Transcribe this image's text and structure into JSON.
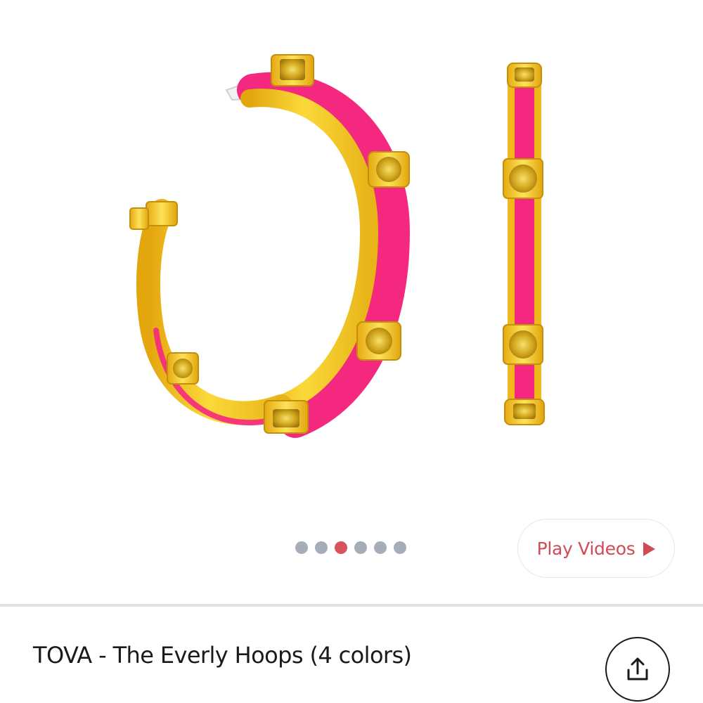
{
  "gallery": {
    "image_alt": "TOVA - The Everly Hoops (4 colors)",
    "image_count": 6,
    "active_index": 2,
    "play_videos_label": "Play Videos",
    "colors": {
      "dot_inactive": "#a7adb8",
      "dot_active": "#d9535f",
      "accent": "#d14b57"
    }
  },
  "product": {
    "title": "TOVA - The Everly Hoops (4 colors)"
  },
  "icons": {
    "play": "play-icon",
    "share": "share-icon"
  }
}
